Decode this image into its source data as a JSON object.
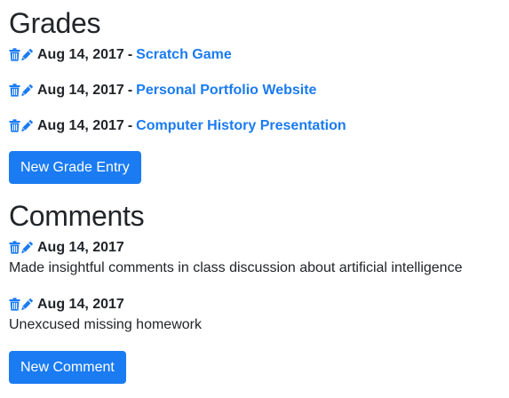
{
  "grades": {
    "heading": "Grades",
    "entries": [
      {
        "date": "Aug 14, 2017",
        "separator": "-",
        "title": "Scratch Game"
      },
      {
        "date": "Aug 14, 2017",
        "separator": "-",
        "title": "Personal Portfolio Website"
      },
      {
        "date": "Aug 14, 2017",
        "separator": "-",
        "title": "Computer History Presentation"
      }
    ],
    "new_button_label": "New Grade Entry"
  },
  "comments": {
    "heading": "Comments",
    "entries": [
      {
        "date": "Aug 14, 2017",
        "text": "Made insightful comments in class discussion about artificial intelligence"
      },
      {
        "date": "Aug 14, 2017",
        "text": "Unexcused missing homework"
      }
    ],
    "new_button_label": "New Comment"
  },
  "icons": {
    "delete": "trash-icon",
    "edit": "pencil-icon"
  },
  "colors": {
    "accent": "#1a7bf2",
    "text": "#212529"
  }
}
